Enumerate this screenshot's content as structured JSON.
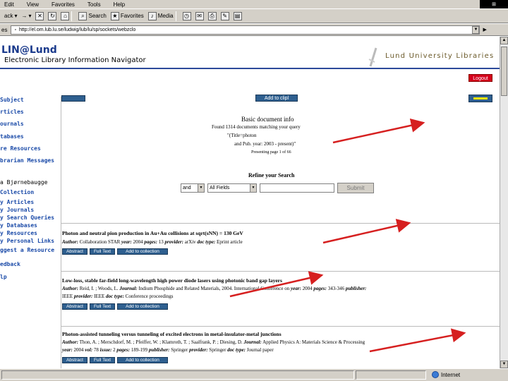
{
  "browser": {
    "menu": [
      "Edit",
      "View",
      "Favorites",
      "Tools",
      "Help"
    ],
    "toolbar": {
      "back": "ack",
      "search": "Search",
      "favorites": "Favorites",
      "media": "Media"
    },
    "address": {
      "label": "es",
      "url": "http://el.om.lub.lu.se/ludwig/lub/lu/sp/sockets/webzclo"
    },
    "status_zone": "Internet"
  },
  "header": {
    "title": "LIN@Lund",
    "subtitle": "Electronic Library Information Navigator",
    "library": "Lund University Libraries",
    "logout": "Logout"
  },
  "nav": [
    {
      "label": "Subject",
      "style": "link"
    },
    {
      "label": "rticles",
      "style": "link"
    },
    {
      "label": "ournals",
      "style": "link"
    },
    {
      "label": "tabases",
      "style": "link"
    },
    {
      "label": "re Resources",
      "style": "link"
    },
    {
      "label": "brarian Messages",
      "style": "link"
    },
    {
      "label": "a Bjørnebaugge",
      "style": "plain"
    },
    {
      "label": "Collection",
      "style": "link"
    },
    {
      "label": "y Articles",
      "style": "link"
    },
    {
      "label": "y Journals",
      "style": "link"
    },
    {
      "label": "y Search Queries",
      "style": "link"
    },
    {
      "label": "y Databases",
      "style": "link"
    },
    {
      "label": "y Resources",
      "style": "link"
    },
    {
      "label": "y Personal Links",
      "style": "link"
    },
    {
      "label": "ggest a Resource",
      "style": "link"
    },
    {
      "label": "edback",
      "style": "link"
    },
    {
      "label": "lp",
      "style": "link"
    }
  ],
  "top_buttons": {
    "add_to_clip": "Add to clipl"
  },
  "info": {
    "heading": "Basic document info",
    "line1": "Found 1314 documents matching your query",
    "line2": "\"(Title=photon",
    "line3": "and Pub. year: 2003 - present)\"",
    "showing": "Presenting page 1 of 66"
  },
  "refine": {
    "heading": "Refine your Search",
    "op": "and",
    "field": "All Fields",
    "input_value": "",
    "submit": "Submit"
  },
  "results": [
    {
      "title": "Photon and neutral pion production in Au+Au collisions at sqrt(sNN) = 130 GeV",
      "meta": [
        [
          "Author:",
          " Collaboration STAR "
        ],
        [
          "year:",
          " 2004 "
        ],
        [
          "pages:",
          " 13 "
        ],
        [
          "provider:",
          " arXiv "
        ],
        [
          "doc type:",
          " Eprint article"
        ]
      ],
      "meta2": null
    },
    {
      "title": "Low-loss, stable far-field long-wavelength high power diode lasers using photonic band gap layers",
      "meta": [
        [
          "Author:",
          " Reid, I. ; Woods, L. "
        ],
        [
          "Journal:",
          " Indium Phosphide and Related Materials, 2004. International Conference on "
        ],
        [
          "year:",
          " 2004 "
        ],
        [
          "pages:",
          " 343-346 "
        ],
        [
          "publisher:",
          ""
        ]
      ],
      "meta2": [
        [
          "",
          "IEEE "
        ],
        [
          "provider:",
          " IEEE "
        ],
        [
          "doc type:",
          " Conference proceedings"
        ]
      ]
    },
    {
      "title": "Photon-assisted tunneling versus tunneling of excited electrons in metal-insulator-metal junctions",
      "meta": [
        [
          "Author:",
          " Thon, A. ; Merschdorf, M. ; Pfeiffer, W. ; Klamroth, T. ; Saalfrank, P. ; Diesing, D. "
        ],
        [
          "Journal:",
          " Applied Physics A: Materials Science & Processing"
        ]
      ],
      "meta2": [
        [
          "year:",
          " 2004 "
        ],
        [
          "vol:",
          " 78 "
        ],
        [
          "issue:",
          " 2 "
        ],
        [
          "pages:",
          " 189-199 "
        ],
        [
          "publisher:",
          " Springer "
        ],
        [
          "provider:",
          " Springer "
        ],
        [
          "doc type:",
          " Journal paper"
        ]
      ]
    }
  ],
  "result_buttons": {
    "abstract": "Abstract",
    "fulltext": "Full Text",
    "add": "Add to collection"
  },
  "colors": {
    "accent": "#2e5f8f",
    "brand": "#1a3a8c",
    "arrow": "#d62020",
    "logout": "#d4001c"
  }
}
